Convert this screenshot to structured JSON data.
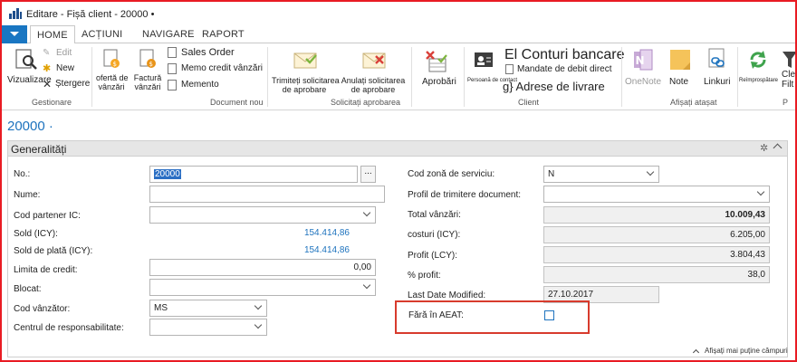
{
  "window": {
    "title": "Editare - Fișă client - 20000 •"
  },
  "tabs": [
    "HOME",
    "ACȚIUNI",
    "NAVIGARE",
    "RAPORT"
  ],
  "ribbon": {
    "gestionare": {
      "vizualizare": "Vizualizare",
      "edit": "Edit",
      "new": "New",
      "stergere": "Ștergere",
      "group": "Gestionare"
    },
    "document": {
      "oferta_1": "ofertă de",
      "oferta_2": "vânzări",
      "factura_1": "Factură",
      "factura_2": "vânzări",
      "sales_order": "Sales Order",
      "memo_credit": "Memo credit vânzări",
      "memento": "Memento",
      "group": "Document nou"
    },
    "solicitari": {
      "trimiteti_1": "Trimiteți solicitarea",
      "trimiteti_2": "de aprobare",
      "anulati_1": "Anulați solicitarea",
      "anulati_2": "de aprobare",
      "group": "Solicitați aprobarea"
    },
    "aprobari": "Aprobări",
    "client": {
      "small_label": "Persoană de contact",
      "conturi": "El Conturi bancare",
      "mandate": "Mandate de debit direct",
      "adrese": "g} Adrese de livrare",
      "group": "Client"
    },
    "atasat": {
      "onenote": "OneNote",
      "note": "Note",
      "linkuri": "Linkuri",
      "group": "Afișați atașat"
    },
    "reimprospatare": "Reîmprospătare",
    "clear_1": "Cle",
    "clear_2": "Filt",
    "extra_group": "P"
  },
  "page": {
    "title": "20000 ·"
  },
  "panel": {
    "title": "Generalități",
    "footer_link": "Afișați mai puține câmpuri"
  },
  "left_fields": {
    "no_label": "No.:",
    "no_value": "20000",
    "nume_label": "Nume:",
    "cod_partener_label": "Cod partener IC:",
    "sold_label": "Sold (ICY):",
    "sold_value": "154.414,86",
    "sold_plata_label": "Sold de plată (ICY):",
    "sold_plata_value": "154.414,86",
    "limita_label": "Limita de credit:",
    "limita_value": "0,00",
    "blocat_label": "Blocat:",
    "cod_vanzator_label": "Cod vânzător:",
    "cod_vanzator_value": "MS",
    "centru_label": "Centrul de responsabilitate:"
  },
  "right_fields": {
    "cod_zona_label": "Cod zonă de serviciu:",
    "cod_zona_value": "N",
    "profil_label": "Profil de trimitere document:",
    "total_label": "Total vânzări:",
    "total_value": "10.009,43",
    "costuri_label": "costuri (ICY):",
    "costuri_value": "6.205,00",
    "profit_label": "Profit (LCY):",
    "profit_value": "3.804,43",
    "pct_label": "% profit:",
    "pct_value": "38,0",
    "last_mod_label": "Last Date Modified:",
    "last_mod_value": "27.10.2017",
    "fara_label": "Fără în AEAT:"
  },
  "colors": {
    "accent": "#1e73be",
    "highlight": "#d83b2d",
    "frame": "#e81b23"
  }
}
